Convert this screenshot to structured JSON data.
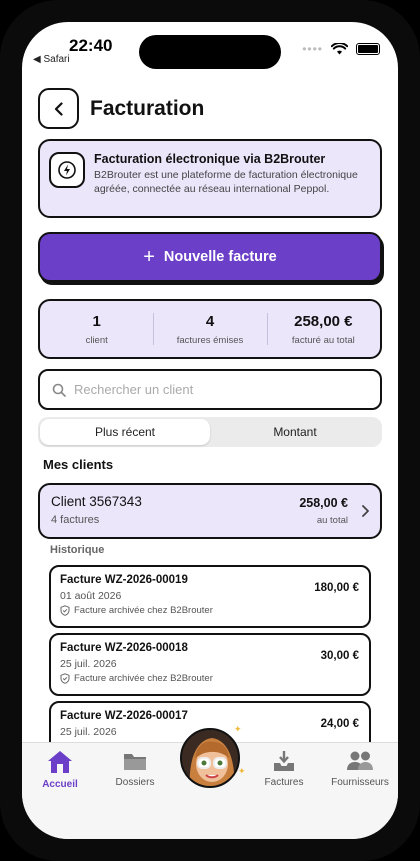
{
  "status_bar": {
    "time": "22:40",
    "back_app": "◀ Safari"
  },
  "header": {
    "title": "Facturation"
  },
  "info": {
    "title": "Facturation électronique via B2Brouter",
    "description": "B2Brouter est une plateforme de facturation électronique agréée, connectée au réseau international Peppol."
  },
  "new_invoice": {
    "label": "Nouvelle facture"
  },
  "stats": [
    {
      "value": "1",
      "label": "client"
    },
    {
      "value": "4",
      "label": "factures émises"
    },
    {
      "value": "258,00 €",
      "label": "facturé au total"
    }
  ],
  "search": {
    "placeholder": "Rechercher un client"
  },
  "sort": {
    "options": [
      "Plus récent",
      "Montant"
    ],
    "selected": "Plus récent"
  },
  "clients_section": {
    "title": "Mes clients"
  },
  "client": {
    "name": "Client 3567343",
    "count": "4 factures",
    "amount": "258,00 €",
    "amount_label": "au total"
  },
  "history": {
    "title": "Historique",
    "invoices": [
      {
        "number": "Facture WZ-2026-00019",
        "date": "01 août 2026",
        "status": "Facture archivée chez B2Brouter",
        "amount": "180,00 €"
      },
      {
        "number": "Facture WZ-2026-00018",
        "date": "25 juil. 2026",
        "status": "Facture archivée chez B2Brouter",
        "amount": "30,00 €"
      },
      {
        "number": "Facture WZ-2026-00017",
        "date": "25 juil. 2026",
        "status": "",
        "amount": "24,00 €"
      }
    ]
  },
  "tabbar": {
    "items": [
      {
        "label": "Accueil",
        "icon": "home-icon",
        "active": true
      },
      {
        "label": "Dossiers",
        "icon": "folder-icon",
        "active": false
      },
      {
        "label": "",
        "icon": "avatar",
        "active": false
      },
      {
        "label": "Factures",
        "icon": "inbox-download-icon",
        "active": false
      },
      {
        "label": "Fournisseurs",
        "icon": "users-icon",
        "active": false
      }
    ]
  },
  "colors": {
    "accent": "#6b3fc7",
    "card_bg": "#ece6fb"
  }
}
